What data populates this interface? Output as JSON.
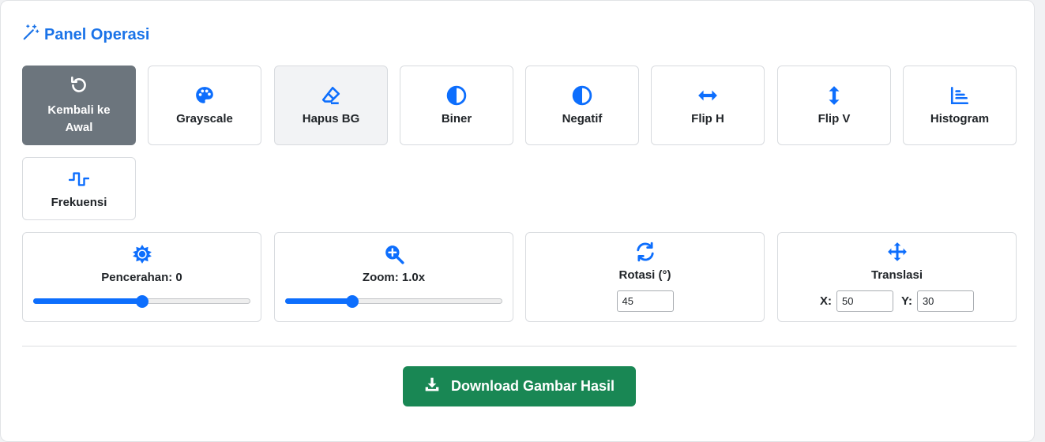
{
  "panel": {
    "title": "Panel Operasi",
    "title_icon": "magic-wand-icon",
    "accent_color": "#1a73e8"
  },
  "operations": [
    {
      "label": "Kembali ke Awal",
      "icon": "undo-icon"
    },
    {
      "label": "Grayscale",
      "icon": "palette-icon"
    },
    {
      "label": "Hapus BG",
      "icon": "eraser-icon"
    },
    {
      "label": "Biner",
      "icon": "half-circle-icon"
    },
    {
      "label": "Negatif",
      "icon": "half-circle-icon"
    },
    {
      "label": "Flip H",
      "icon": "arrows-horizontal-icon"
    },
    {
      "label": "Flip V",
      "icon": "arrows-vertical-icon"
    },
    {
      "label": "Histogram",
      "icon": "chart-bars-icon"
    },
    {
      "label": "Frekuensi",
      "icon": "wave-square-icon"
    }
  ],
  "controls": {
    "brightness": {
      "label": "Pencerahan: 0",
      "icon": "sun-icon",
      "value": 0,
      "min": -100,
      "max": 100
    },
    "zoom": {
      "label": "Zoom: 1.0x",
      "icon": "zoom-in-icon",
      "value": 1.0,
      "min": 0.1,
      "max": 3.0
    },
    "rotation": {
      "label": "Rotasi (°)",
      "icon": "rotate-icon",
      "value": "45"
    },
    "translation": {
      "label": "Translasi",
      "icon": "move-arrows-icon",
      "x_label": "X:",
      "x_value": "50",
      "y_label": "Y:",
      "y_value": "30"
    }
  },
  "download": {
    "label": "Download Gambar Hasil",
    "icon": "download-icon",
    "color": "#198754"
  }
}
